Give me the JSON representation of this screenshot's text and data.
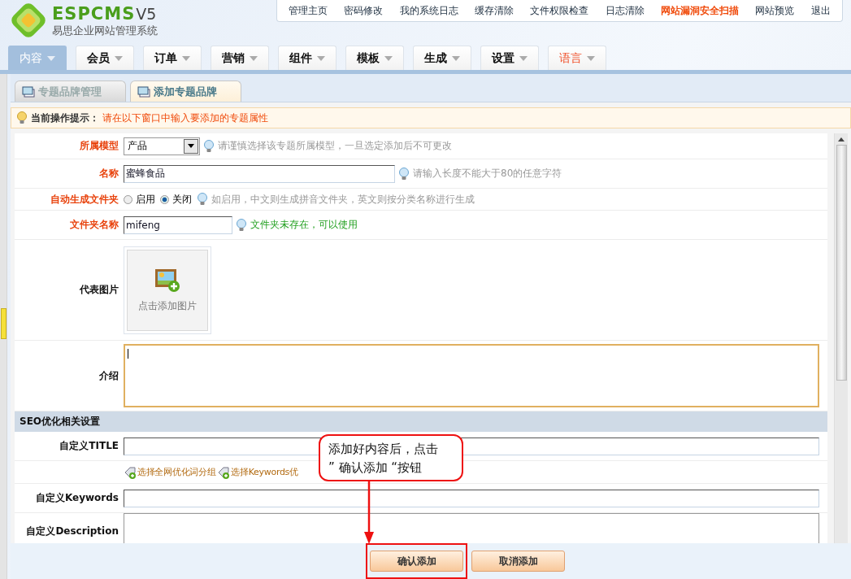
{
  "logo": {
    "brand": "ESPCMS",
    "version": "V5",
    "subtitle": "易思企业网站管理系统"
  },
  "top_links": [
    {
      "label": "管理主页",
      "highlight": false
    },
    {
      "label": "密码修改",
      "highlight": false
    },
    {
      "label": "我的系统日志",
      "highlight": false
    },
    {
      "label": "缓存清除",
      "highlight": false
    },
    {
      "label": "文件权限检查",
      "highlight": false
    },
    {
      "label": "日志清除",
      "highlight": false
    },
    {
      "label": "网站漏洞安全扫描",
      "highlight": true
    },
    {
      "label": "网站预览",
      "highlight": false
    },
    {
      "label": "退出",
      "highlight": false
    }
  ],
  "nav": [
    {
      "label": "内容",
      "selected": true,
      "highlight": false
    },
    {
      "label": "会员",
      "selected": false,
      "highlight": false
    },
    {
      "label": "订单",
      "selected": false,
      "highlight": false
    },
    {
      "label": "营销",
      "selected": false,
      "highlight": false
    },
    {
      "label": "组件",
      "selected": false,
      "highlight": false
    },
    {
      "label": "模板",
      "selected": false,
      "highlight": false
    },
    {
      "label": "生成",
      "selected": false,
      "highlight": false
    },
    {
      "label": "设置",
      "selected": false,
      "highlight": false
    },
    {
      "label": "语言",
      "selected": false,
      "highlight": true
    }
  ],
  "tabs": [
    {
      "label": "专题品牌管理",
      "selected": false
    },
    {
      "label": "添加专题品牌",
      "selected": true
    }
  ],
  "tip": {
    "label": "当前操作提示：",
    "text": "请在以下窗口中输入要添加的专题属性"
  },
  "form": [
    {
      "kind": "select",
      "label": "所属模型",
      "required": true,
      "value": "产品",
      "hint": "请谨慎选择该专题所属模型，一旦选定添加后不可更改",
      "hint_ok": false
    },
    {
      "kind": "text",
      "label": "名称",
      "required": true,
      "value": "蜜蜂食品",
      "hint": "请输入长度不能大于80的任意字符",
      "hint_ok": false
    },
    {
      "kind": "radio",
      "label": "自动生成文件夹",
      "required": true,
      "options": [
        {
          "label": "启用",
          "selected": false
        },
        {
          "label": "关闭",
          "selected": true
        }
      ],
      "hint": "如启用，中文则生成拼音文件夹，英文则按分类名称进行生成",
      "hint_ok": false
    },
    {
      "kind": "text",
      "label": "文件夹名称",
      "required": true,
      "value": "mifeng",
      "hint": "文件夹未存在，可以使用",
      "hint_ok": true
    },
    {
      "kind": "image",
      "label": "代表图片",
      "required": false,
      "button": "点击添加图片"
    },
    {
      "kind": "textarea",
      "label": "介绍",
      "required": false,
      "focused": true
    },
    {
      "kind": "section",
      "label": "SEO优化相关设置"
    },
    {
      "kind": "text",
      "label": "自定义TITLE",
      "required": false
    },
    {
      "kind": "links",
      "links": [
        "选择全网优化词分组",
        "选择Keywords优"
      ]
    },
    {
      "kind": "text",
      "label": "自定义Keywords",
      "required": false
    },
    {
      "kind": "textarea",
      "label": "自定义Description",
      "required": false,
      "focused": false
    }
  ],
  "buttons": [
    {
      "label": "确认添加",
      "highlighted": true
    },
    {
      "label": "取消添加",
      "highlighted": false
    }
  ],
  "callout": {
    "lines": [
      "添加好内容后，点击",
      "” 确认添加 “按钮"
    ]
  }
}
